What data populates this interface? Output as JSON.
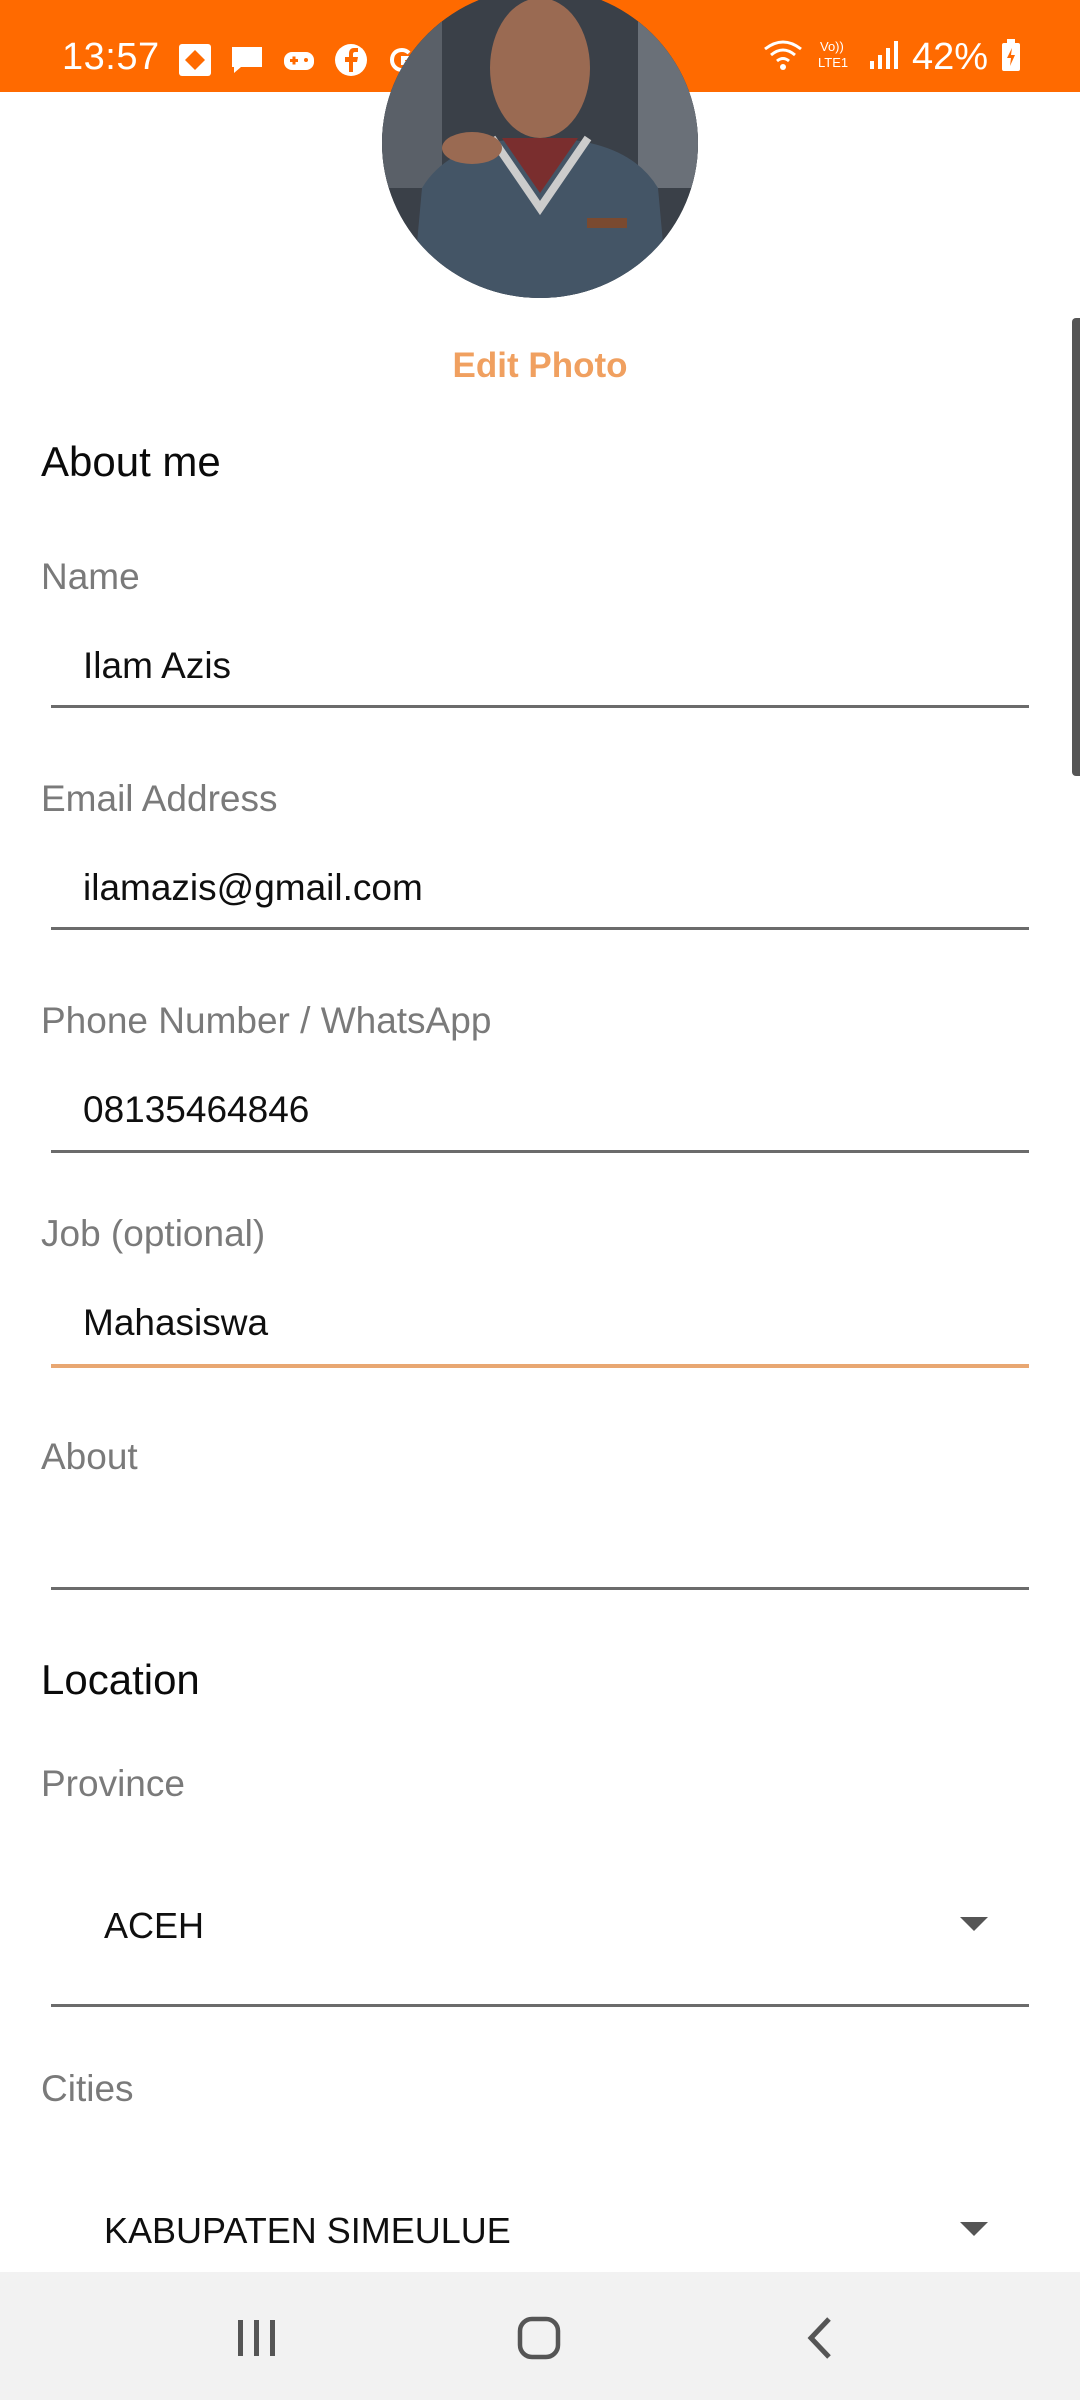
{
  "status_bar": {
    "time": "13:57",
    "battery": "42%",
    "icons": [
      "gallery-icon",
      "message-icon",
      "gamepad-icon",
      "facebook-icon",
      "google-icon",
      "dot-icon",
      "wifi-icon",
      "volte-icon",
      "signal-icon",
      "battery-icon"
    ],
    "background": "#ff6a00"
  },
  "profile": {
    "edit_photo_label": "Edit Photo"
  },
  "about": {
    "title": "About me",
    "fields": [
      {
        "label": "Name",
        "value": "Ilam Azis"
      },
      {
        "label": "Email Address",
        "value": "ilamazis@gmail.com"
      },
      {
        "label": "Phone Number / WhatsApp",
        "value": "08135464846"
      },
      {
        "label": "Job (optional)",
        "value": "Mahasiswa"
      },
      {
        "label": "About",
        "value": ""
      }
    ]
  },
  "location": {
    "title": "Location",
    "province": {
      "label": "Province",
      "value": "ACEH"
    },
    "city": {
      "label": "Cities",
      "value": "KABUPATEN SIMEULUE"
    }
  },
  "colors": {
    "accent": "#f0a060",
    "active_underline": "#e8a772",
    "label": "#7a7a7a"
  },
  "nav_bar": {
    "icons": [
      "recent-apps-icon",
      "home-icon",
      "back-icon"
    ]
  }
}
